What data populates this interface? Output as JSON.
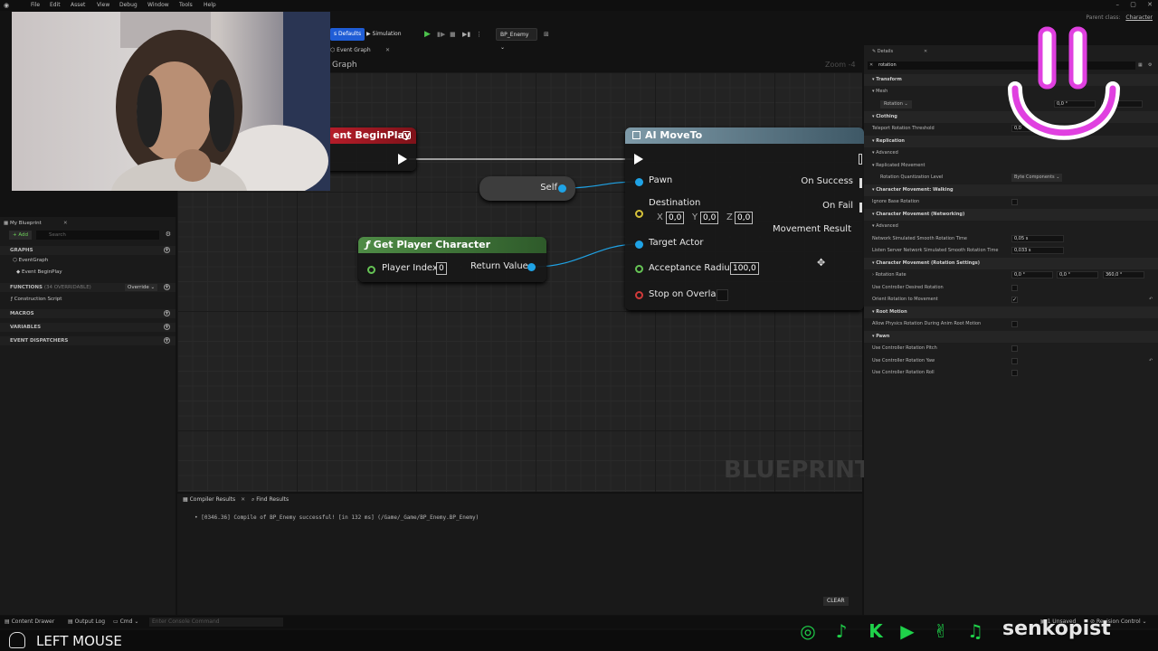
{
  "menu": [
    "File",
    "Edit",
    "Asset",
    "View",
    "Debug",
    "Window",
    "Tools",
    "Help"
  ],
  "window_controls": [
    "–",
    "▢",
    "✕"
  ],
  "parent_class": {
    "label": "Parent class:",
    "value": "Character"
  },
  "toolbar": {
    "class_defaults": "s Defaults",
    "simulation": "Simulation",
    "debug_object": "BP_Enemy"
  },
  "graph_tab": {
    "label": "Event Graph",
    "title": "Graph",
    "zoom": "Zoom -4"
  },
  "watermark": "BLUEPRINT",
  "nodes": {
    "begin_play": {
      "title": "ent BeginPlay"
    },
    "self": {
      "label": "Self"
    },
    "get_player": {
      "title": "Get Player Character",
      "player_index_label": "Player Index",
      "player_index_value": "0",
      "return_value": "Return Value"
    },
    "ai_move_to": {
      "title": "AI MoveTo",
      "pawn": "Pawn",
      "destination": "Destination",
      "x_label": "X",
      "x_value": "0,0",
      "y_label": "Y",
      "y_value": "0,0",
      "z_label": "Z",
      "z_value": "0,0",
      "target_actor": "Target Actor",
      "acceptance_radius": "Acceptance Radius",
      "acceptance_radius_value": "100,0",
      "stop_on_overlap": "Stop on Overlap",
      "on_success": "On Success",
      "on_fail": "On Fail",
      "movement_result": "Movement Result"
    }
  },
  "my_blueprint": {
    "tab": "My Blueprint",
    "add": "+ Add",
    "search_placeholder": "Search",
    "graphs": "GRAPHS",
    "event_graph": "EventGraph",
    "event_begin_play": "Event BeginPlay",
    "functions": "FUNCTIONS",
    "functions_count": "(34 OVERRIDABLE)",
    "override": "Override",
    "construction_script": "Construction Script",
    "macros": "MACROS",
    "variables": "VARIABLES",
    "event_dispatchers": "EVENT DISPATCHERS"
  },
  "details": {
    "tab": "Details",
    "search_value": "rotation",
    "rows": {
      "transform": "Transform",
      "mesh": "Mesh",
      "rotation": "Rotation",
      "rotation_x": "0,0 °",
      "rotation_y": "0,0 °",
      "clothing": "Clothing",
      "teleport": "Teleport Rotation Threshold",
      "teleport_value": "0,0",
      "replication": "Replication",
      "advanced": "Advanced",
      "replicated_movement": "Replicated Movement",
      "rot_quant": "Rotation Quantization Level",
      "rot_quant_value": "Byte Components",
      "cm_walking": "Character Movement: Walking",
      "ignore_base": "Ignore Base Rotation",
      "cm_networking": "Character Movement (Networking)",
      "advanced2": "Advanced",
      "net_smooth": "Network Simulated Smooth Rotation Time",
      "net_smooth_value": "0,05 s",
      "listen_smooth": "Listen Server Network Simulated Smooth Rotation Time",
      "listen_smooth_value": "0,033 s",
      "cm_rotation": "Character Movement (Rotation Settings)",
      "rotation_rate": "Rotation Rate",
      "rr_x": "0,0 °",
      "rr_y": "0,0 °",
      "rr_z": "360,0 °",
      "use_controller_desired": "Use Controller Desired Rotation",
      "orient_rotation": "Orient Rotation to Movement",
      "root_motion": "Root Motion",
      "allow_physics": "Allow Physics Rotation During Anim Root Motion",
      "pawn": "Pawn",
      "ucr_pitch": "Use Controller Rotation Pitch",
      "ucr_yaw": "Use Controller Rotation Yaw",
      "ucr_roll": "Use Controller Rotation Roll"
    }
  },
  "console": {
    "tab1": "Compiler Results",
    "tab2": "Find Results",
    "line": "• [0346.36] Compile of BP_Enemy successful! [in 132 ms] (/Game/_Game/BP_Enemy.BP_Enemy)",
    "clear": "CLEAR"
  },
  "statusbar": {
    "content_drawer": "Content Drawer",
    "output_log": "Output Log",
    "cmd": "Cmd",
    "cmd_placeholder": "Enter Console Command",
    "unsaved": "1 Unsaved",
    "revision": "Revision Control"
  },
  "overlay": {
    "left_mouse": "LEFT MOUSE",
    "handle": "senkopist"
  },
  "colors": {
    "social_green": "#1fd24a",
    "smiley_pink": "#e040e0",
    "accent_blue": "#1f5dd6"
  }
}
